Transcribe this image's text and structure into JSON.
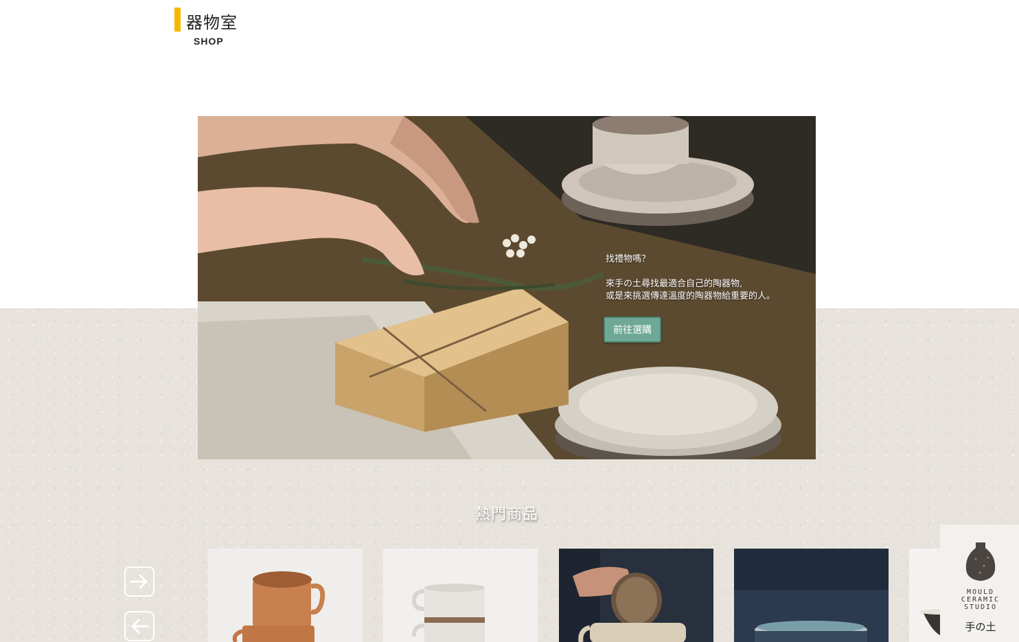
{
  "logo": {
    "title": "器物室",
    "subtitle": "SHOP"
  },
  "hero": {
    "question": "找禮物嗎？",
    "line1": "來手の土尋找最適合自己的陶器物,",
    "line2": "或是來挑選傳達溫度的陶器物給重要的人。",
    "cta_label": "前往選購"
  },
  "popular": {
    "title": "熱門商品"
  },
  "carousel": {
    "next_icon": "arrow-right-icon",
    "prev_icon": "arrow-left-icon"
  },
  "badge": {
    "line1": "MOULD",
    "line2": "CERAMIC",
    "line3": "STUDIO",
    "name": "手の土"
  },
  "colors": {
    "logo_accent": "#f5b800",
    "cta": "#6fa896"
  }
}
